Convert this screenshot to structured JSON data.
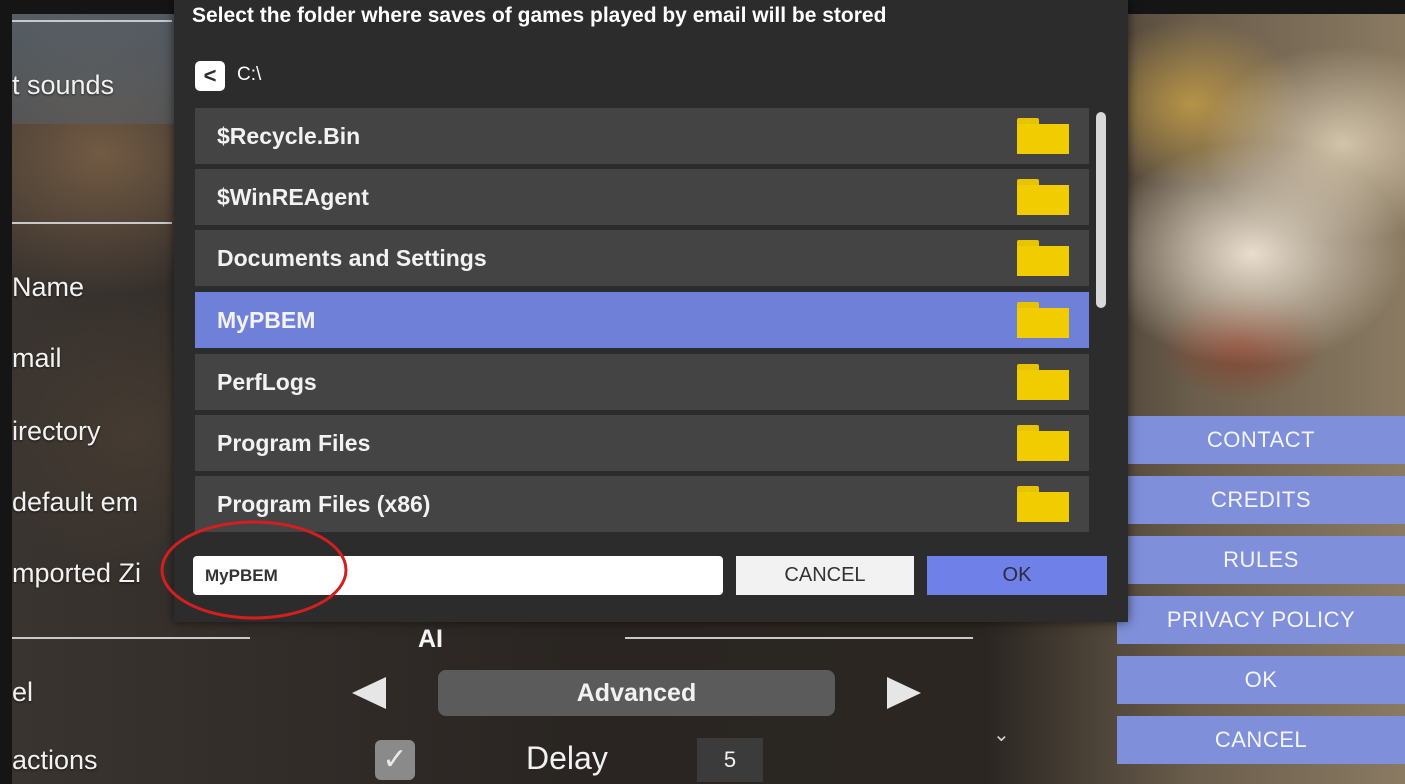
{
  "dialog": {
    "title": "Select the folder where saves of games played by email will be stored",
    "current_path": "C:\\",
    "back_icon": "chevron-left-icon",
    "folders": [
      {
        "name": "$Recycle.Bin",
        "selected": false
      },
      {
        "name": "$WinREAgent",
        "selected": false
      },
      {
        "name": "Documents and Settings",
        "selected": false
      },
      {
        "name": "MyPBEM",
        "selected": true
      },
      {
        "name": "PerfLogs",
        "selected": false
      },
      {
        "name": "Program Files",
        "selected": false
      },
      {
        "name": "Program Files (x86)",
        "selected": false
      }
    ],
    "input_value": "MyPBEM",
    "cancel_label": "CANCEL",
    "ok_label": "OK",
    "folder_icon": "folder-icon",
    "colors": {
      "selected_row": "#6f80d8",
      "row": "#444444",
      "folder": "#f0cc00",
      "annotation": "#d21f1f"
    }
  },
  "settings": {
    "labels": {
      "sounds": "t sounds",
      "name": "Name",
      "email": "mail",
      "directory": "irectory",
      "default_email": "default em",
      "imported": "mported Zi",
      "level": "el",
      "actions": "actions"
    },
    "ai_section_label": "AI",
    "level_value": "Advanced",
    "delay_label": "Delay",
    "delay_value": "5",
    "actions_checked": true
  },
  "right_menu": {
    "buttons": [
      "CONTACT",
      "CREDITS",
      "RULES",
      "PRIVACY POLICY",
      "OK",
      "CANCEL"
    ],
    "color": "#7f8fd9"
  }
}
